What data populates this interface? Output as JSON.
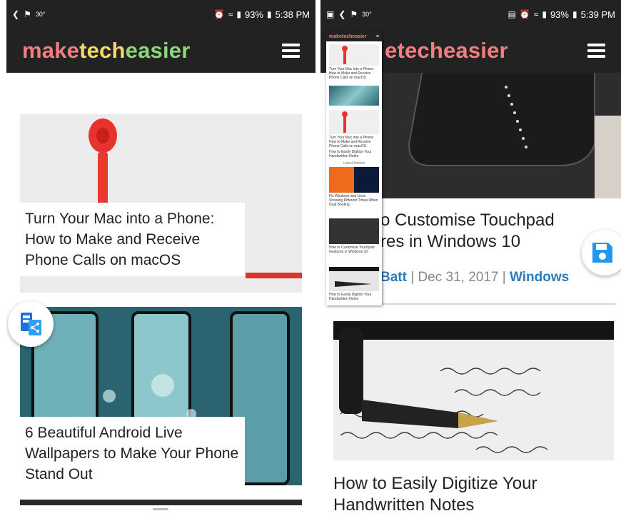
{
  "colors": {
    "header_bg": "#222222",
    "logo_make": "#f37d82",
    "logo_tech": "#f2d96b",
    "logo_easier": "#8fd67a",
    "link_blue": "#2b7bb9",
    "fab_blue": "#2196f3"
  },
  "left_phone": {
    "status": {
      "left_tiny": "30°",
      "time": "5:38 PM",
      "battery": "93%"
    },
    "logo": {
      "make": "make",
      "tech": "tech",
      "easier": "easier"
    },
    "articles": [
      {
        "title": "Turn Your Mac into a Phone: How to Make and Receive Phone Calls on macOS"
      },
      {
        "title": "6 Beautiful Android Live Wallpapers to Make Your Phone Stand Out"
      }
    ],
    "fab_icon": "share-tabs-icon"
  },
  "right_phone": {
    "status": {
      "left_tiny": "30°",
      "time": "5:39 PM",
      "battery": "93%"
    },
    "logo_visible": "etecheasier",
    "article_title": "o Customise Touchpad\nres in Windows 10",
    "meta": {
      "author": "Batt",
      "date": "Dec 31, 2017",
      "category": "Windows",
      "sep": " | "
    },
    "article2_title": "How to Easily Digitize Your Handwritten Notes",
    "fab_icon": "save-icon",
    "overlay": {
      "header_logo": "maketecheasier",
      "items": [
        "Turn Your Mac into a Phone: How to Make and Receive Phone Calls on macOS",
        "Turn Your Mac into a Phone: How to Make and Receive Phone Calls on macOS",
        "How to Easily Digitize Your Handwritten Notes",
        "Latest Articles",
        "Fix Windows and Linux Showing Different Times When Dual Booting",
        "How to Customise Touchpad Gestures in Windows 10",
        "How to Easily Digitize Your Handwritten Notes"
      ]
    }
  }
}
